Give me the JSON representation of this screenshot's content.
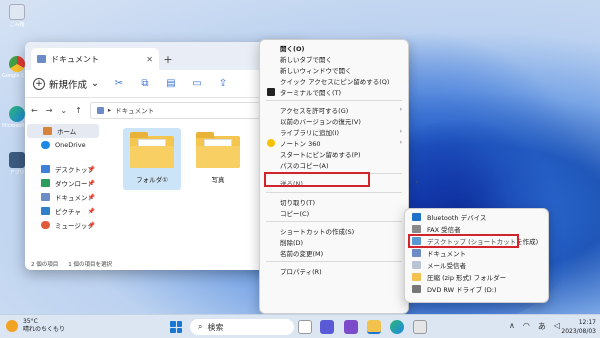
{
  "desktop": {
    "icons": [
      {
        "label": "ごみ箱"
      },
      {
        "label": "Google Chrome"
      },
      {
        "label": "Microsoft Edge"
      },
      {
        "label": "アプリ"
      }
    ]
  },
  "explorer": {
    "tab_title": "ドキュメント",
    "tab_close": "✕",
    "new_tab": "+",
    "window_controls": [
      "—",
      "☐"
    ],
    "new_button": "新規作成",
    "path_root": "▸",
    "path_label": "ドキュメント",
    "nav": {
      "home": "ホーム",
      "onedrive": "OneDrive",
      "desktop": "デスクトップ",
      "downloads": "ダウンロード",
      "documents": "ドキュメント",
      "pictures": "ピクチャ",
      "music": "ミュージック"
    },
    "files": [
      {
        "name": "フォルダ①"
      },
      {
        "name": "写真"
      }
    ],
    "status": {
      "count": "2 個の項目",
      "selected": "1 個の項目を選択"
    }
  },
  "context_menu": {
    "items": {
      "open": "開く(O)",
      "open_new_tab": "新しいタブで開く",
      "open_new_window": "新しいウィンドウで開く",
      "pin_quick_access": "クイック アクセスにピン留めする(Q)",
      "open_terminal": "ターミナルで開く(T)",
      "grant_access": "アクセスを許可する(G)",
      "restore_versions": "以前のバージョンの復元(V)",
      "add_library": "ライブラリに追加(I)",
      "norton": "ノートン 360",
      "pin_start": "スタートにピン留めする(P)",
      "copy_path": "パスのコピー(A)",
      "send_to": "送る(N)",
      "cut": "切り取り(T)",
      "copy": "コピー(C)",
      "create_shortcut": "ショートカットの作成(S)",
      "delete": "削除(D)",
      "rename": "名前の変更(M)",
      "properties": "プロパティ(R)"
    },
    "arrow": "›"
  },
  "send_to_menu": {
    "bluetooth": "Bluetooth デバイス",
    "fax": "FAX 受信者",
    "desktop_shortcut": "デスクトップ (ショートカットを作成)",
    "documents": "ドキュメント",
    "mail": "メール受信者",
    "zip": "圧縮 (zip 形式) フォルダー",
    "dvd": "DVD RW ドライブ (D:)"
  },
  "taskbar": {
    "weather_temp": "35°C",
    "weather_desc": "晴れのちくもり",
    "search_placeholder": "検索",
    "tray_chevron": "∧",
    "tray_input": "あ",
    "time": "12:17",
    "date": "2023/08/03"
  },
  "colors": {
    "highlight_border": "#d2252b",
    "folder_yellow": "#f4c64f",
    "accent_blue": "#1976d2"
  }
}
